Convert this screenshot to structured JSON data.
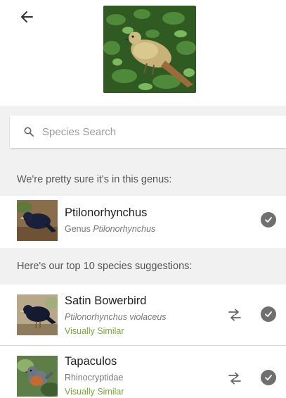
{
  "header": {
    "back_icon": "arrow-left-icon",
    "hero_alt": "Observed bird photo"
  },
  "search": {
    "placeholder": "Species Search",
    "icon": "search-icon"
  },
  "genus_section": {
    "heading": "We're pretty sure it's in this genus:",
    "item": {
      "name": "Ptilonorhynchus",
      "rank_label": "Genus",
      "scientific": "Ptilonorhynchus",
      "icon": "check-circle-icon"
    }
  },
  "species_section": {
    "heading": "Here's our top 10 species suggestions:",
    "items": [
      {
        "name": "Satin Bowerbird",
        "scientific": "Ptilonorhynchus violaceus",
        "match": "Visually Similar",
        "compare_icon": "compare-arrows-icon",
        "check_icon": "check-circle-icon"
      },
      {
        "name": "Tapaculos",
        "scientific": "Rhinocryptidae",
        "match": "Visually Similar",
        "compare_icon": "compare-arrows-icon",
        "check_icon": "check-circle-icon"
      }
    ]
  },
  "colors": {
    "accent_green": "#78a933",
    "section_bg": "#f1f1f1",
    "check_bg": "#6f6f6f"
  }
}
